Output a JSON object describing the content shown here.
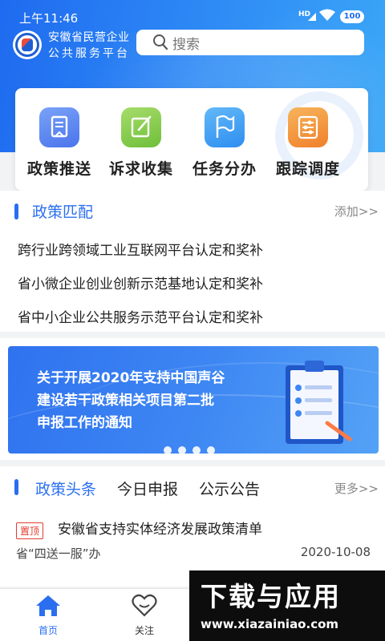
{
  "status": {
    "time": "上午11:46",
    "network": "HD",
    "battery": "100"
  },
  "header": {
    "org_line1": "安徽省民营企业",
    "org_line2": "公共服务平台",
    "search_placeholder": "搜索"
  },
  "functions": [
    {
      "label": "政策推送",
      "icon": "document-icon",
      "color": "#5b86f2"
    },
    {
      "label": "诉求收集",
      "icon": "edit-icon",
      "color": "#8ccf4f"
    },
    {
      "label": "任务分办",
      "icon": "flag-icon",
      "color": "#3fa3f5"
    },
    {
      "label": "跟踪调度",
      "icon": "sliders-icon",
      "color": "#f59a3c"
    }
  ],
  "policy_match": {
    "title": "政策匹配",
    "action": "添加>>",
    "items": [
      "跨行业跨领域工业互联网平台认定和奖补",
      "省小微企业创业创新示范基地认定和奖补",
      "省中小企业公共服务示范平台认定和奖补"
    ]
  },
  "banner": {
    "line1": "关于开展2020年支持中国声谷",
    "line2": "建设若干政策相关项目第二批",
    "line3": "申报工作的通知",
    "slide_count": 4
  },
  "news": {
    "tabs": [
      "政策头条",
      "今日申报",
      "公示公告"
    ],
    "more": "更多>>",
    "items": [
      {
        "tag": "置顶",
        "title": "安徽省支持实体经济发展政策清单",
        "source": "省“四送一服”办",
        "date": "2020-10-08"
      }
    ]
  },
  "tabbar": {
    "items": [
      {
        "label": "首页",
        "icon": "home-icon",
        "active": true
      },
      {
        "label": "关注",
        "icon": "heart-icon",
        "active": false
      }
    ]
  },
  "watermark": {
    "text": "下载与应用",
    "url": "www.xiazainiao.com"
  },
  "colors": {
    "primary": "#2b6ff0",
    "tag_red": "#e23b2e"
  }
}
